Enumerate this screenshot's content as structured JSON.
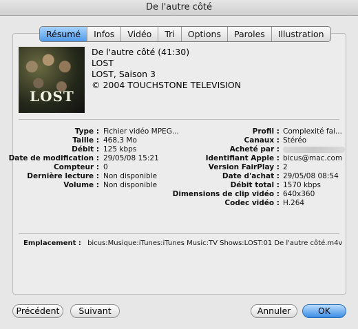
{
  "window": {
    "title": "De l'autre côté"
  },
  "tabs": [
    "Résumé",
    "Infos",
    "Vidéo",
    "Tri",
    "Options",
    "Paroles",
    "Illustration"
  ],
  "summary": {
    "title_line": "De l'autre côté (41:30)",
    "artist": "LOST",
    "album": "LOST, Saison 3",
    "copyright": "© 2004 TOUCHSTONE TELEVISION",
    "artwork_text": "LOST"
  },
  "details_left": [
    {
      "label": "Type :",
      "value": "Fichier vidéo MPEG..."
    },
    {
      "label": "Taille :",
      "value": "468,3 Mo"
    },
    {
      "label": "Débit :",
      "value": "125 kbps"
    },
    {
      "label": "Date de modification :",
      "value": "29/05/08 15:21"
    },
    {
      "label": "Compteur :",
      "value": "0"
    },
    {
      "label": "Dernière lecture :",
      "value": "Non disponible"
    },
    {
      "label": "Volume :",
      "value": "Non disponible"
    }
  ],
  "details_right": [
    {
      "label": "Profil :",
      "value": "Complexité fai..."
    },
    {
      "label": "Canaux :",
      "value": "Stéréo"
    },
    {
      "label": "Acheté par :",
      "value": ""
    },
    {
      "label": "Identifiant Apple :",
      "value": "bicus@mac.com"
    },
    {
      "label": "Version FairPlay :",
      "value": "2"
    },
    {
      "label": "Date d'achat :",
      "value": "29/05/08 08:54"
    },
    {
      "label": "Débit total :",
      "value": "1570 kbps"
    },
    {
      "label": "Dimensions de clip vidéo :",
      "value": "640x360"
    },
    {
      "label": "Codec vidéo :",
      "value": "H.264"
    }
  ],
  "location": {
    "label": "Emplacement :",
    "value": "bicus:Musique:iTunes:iTunes Music:TV Shows:LOST:01 De l'autre côté.m4v"
  },
  "buttons": {
    "previous": "Précédent",
    "next": "Suivant",
    "cancel": "Annuler",
    "ok": "OK"
  }
}
